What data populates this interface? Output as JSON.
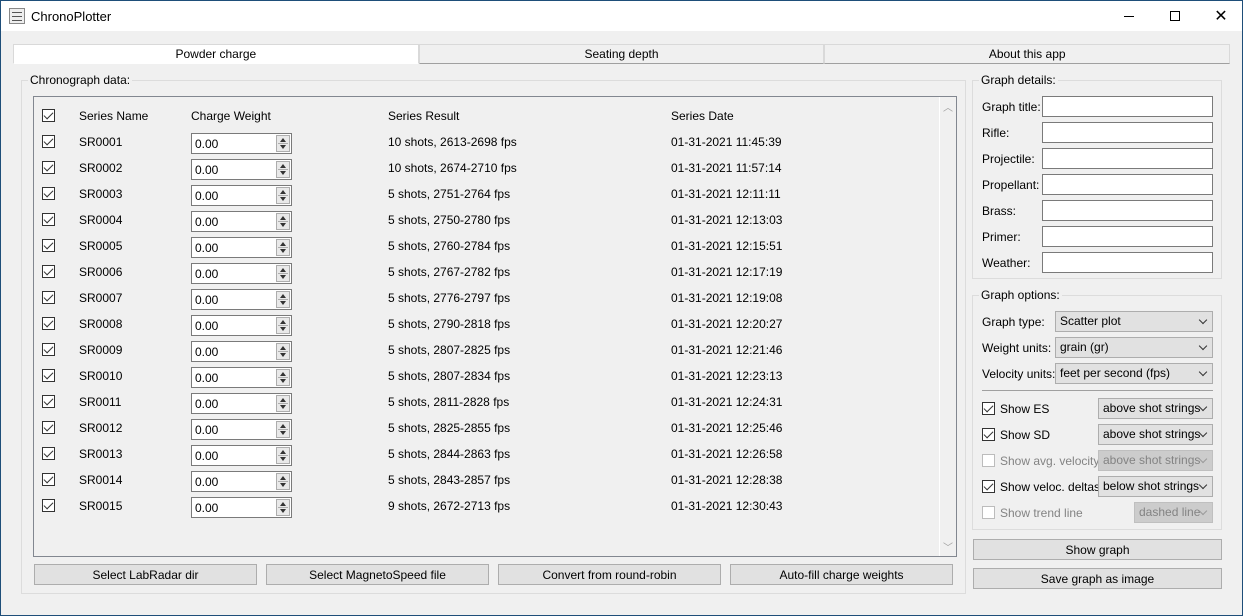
{
  "window": {
    "title": "ChronoPlotter",
    "minimize_label": "minimize",
    "maximize_label": "maximize",
    "close_label": "close"
  },
  "tabs": [
    {
      "label": "Powder charge",
      "active": true
    },
    {
      "label": "Seating depth",
      "active": false
    },
    {
      "label": "About this app",
      "active": false
    }
  ],
  "chronograph": {
    "group_label": "Chronograph data:",
    "headers": {
      "select_all_checked": true,
      "series_name": "Series Name",
      "charge_weight": "Charge Weight",
      "series_result": "Series Result",
      "series_date": "Series Date"
    },
    "rows": [
      {
        "checked": true,
        "name": "SR0001",
        "charge": "0.00",
        "result": "10 shots, 2613-2698 fps",
        "date": "01-31-2021 11:45:39"
      },
      {
        "checked": true,
        "name": "SR0002",
        "charge": "0.00",
        "result": "10 shots, 2674-2710 fps",
        "date": "01-31-2021 11:57:14"
      },
      {
        "checked": true,
        "name": "SR0003",
        "charge": "0.00",
        "result": "5 shots, 2751-2764 fps",
        "date": "01-31-2021 12:11:11"
      },
      {
        "checked": true,
        "name": "SR0004",
        "charge": "0.00",
        "result": "5 shots, 2750-2780 fps",
        "date": "01-31-2021 12:13:03"
      },
      {
        "checked": true,
        "name": "SR0005",
        "charge": "0.00",
        "result": "5 shots, 2760-2784 fps",
        "date": "01-31-2021 12:15:51"
      },
      {
        "checked": true,
        "name": "SR0006",
        "charge": "0.00",
        "result": "5 shots, 2767-2782 fps",
        "date": "01-31-2021 12:17:19"
      },
      {
        "checked": true,
        "name": "SR0007",
        "charge": "0.00",
        "result": "5 shots, 2776-2797 fps",
        "date": "01-31-2021 12:19:08"
      },
      {
        "checked": true,
        "name": "SR0008",
        "charge": "0.00",
        "result": "5 shots, 2790-2818 fps",
        "date": "01-31-2021 12:20:27"
      },
      {
        "checked": true,
        "name": "SR0009",
        "charge": "0.00",
        "result": "5 shots, 2807-2825 fps",
        "date": "01-31-2021 12:21:46"
      },
      {
        "checked": true,
        "name": "SR0010",
        "charge": "0.00",
        "result": "5 shots, 2807-2834 fps",
        "date": "01-31-2021 12:23:13"
      },
      {
        "checked": true,
        "name": "SR0011",
        "charge": "0.00",
        "result": "5 shots, 2811-2828 fps",
        "date": "01-31-2021 12:24:31"
      },
      {
        "checked": true,
        "name": "SR0012",
        "charge": "0.00",
        "result": "5 shots, 2825-2855 fps",
        "date": "01-31-2021 12:25:46"
      },
      {
        "checked": true,
        "name": "SR0013",
        "charge": "0.00",
        "result": "5 shots, 2844-2863 fps",
        "date": "01-31-2021 12:26:58"
      },
      {
        "checked": true,
        "name": "SR0014",
        "charge": "0.00",
        "result": "5 shots, 2843-2857 fps",
        "date": "01-31-2021 12:28:38"
      },
      {
        "checked": true,
        "name": "SR0015",
        "charge": "0.00",
        "result": "9 shots, 2672-2713 fps",
        "date": "01-31-2021 12:30:43"
      }
    ],
    "buttons": {
      "labradar": "Select LabRadar dir",
      "magnetospeed": "Select MagnetoSpeed file",
      "round_robin": "Convert from round-robin",
      "autofill": "Auto-fill charge weights"
    }
  },
  "graph_details": {
    "group_label": "Graph details:",
    "fields": [
      {
        "label": "Graph title:",
        "value": ""
      },
      {
        "label": "Rifle:",
        "value": ""
      },
      {
        "label": "Projectile:",
        "value": ""
      },
      {
        "label": "Propellant:",
        "value": ""
      },
      {
        "label": "Brass:",
        "value": ""
      },
      {
        "label": "Primer:",
        "value": ""
      },
      {
        "label": "Weather:",
        "value": ""
      }
    ]
  },
  "graph_options": {
    "group_label": "Graph options:",
    "graph_type": {
      "label": "Graph type:",
      "value": "Scatter plot"
    },
    "weight_units": {
      "label": "Weight units:",
      "value": "grain (gr)"
    },
    "velocity_units": {
      "label": "Velocity units:",
      "value": "feet per second (fps)"
    },
    "toggles": [
      {
        "label": "Show ES",
        "checked": true,
        "enabled": true,
        "position": "above shot strings"
      },
      {
        "label": "Show SD",
        "checked": true,
        "enabled": true,
        "position": "above shot strings"
      },
      {
        "label": "Show avg. velocity",
        "checked": false,
        "enabled": false,
        "position": "above shot strings"
      },
      {
        "label": "Show veloc. deltas",
        "checked": true,
        "enabled": true,
        "position": "below shot strings"
      },
      {
        "label": "Show trend line",
        "checked": false,
        "enabled": false,
        "position": "dashed line"
      }
    ]
  },
  "actions": {
    "show_graph": "Show graph",
    "save_graph": "Save graph as image"
  }
}
